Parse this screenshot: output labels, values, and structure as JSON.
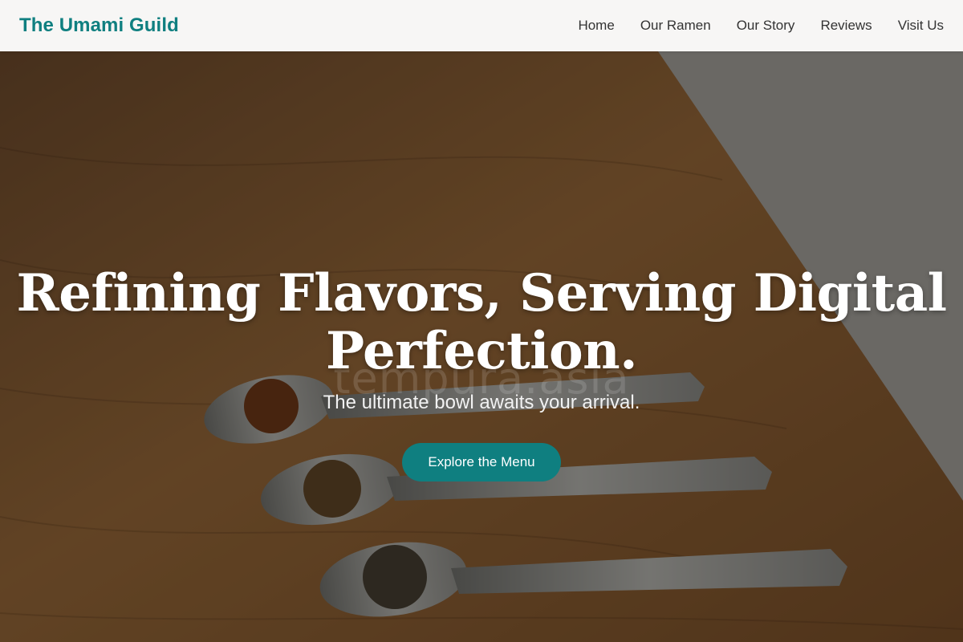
{
  "brand": {
    "name": "The Umami Guild",
    "accent_color": "#0f7f80"
  },
  "nav": {
    "items": [
      {
        "label": "Home"
      },
      {
        "label": "Our Ramen"
      },
      {
        "label": "Our Story"
      },
      {
        "label": "Reviews"
      },
      {
        "label": "Visit Us"
      }
    ]
  },
  "hero": {
    "headline_line1": "Refining Flavors, Serving Digital",
    "headline_line2": "Perfection.",
    "subheadline": "The ultimate bowl awaits your arrival.",
    "cta_label": "Explore the Menu",
    "watermark": "tempura.asia",
    "image": "wooden-table-spoons-spices-photo"
  }
}
